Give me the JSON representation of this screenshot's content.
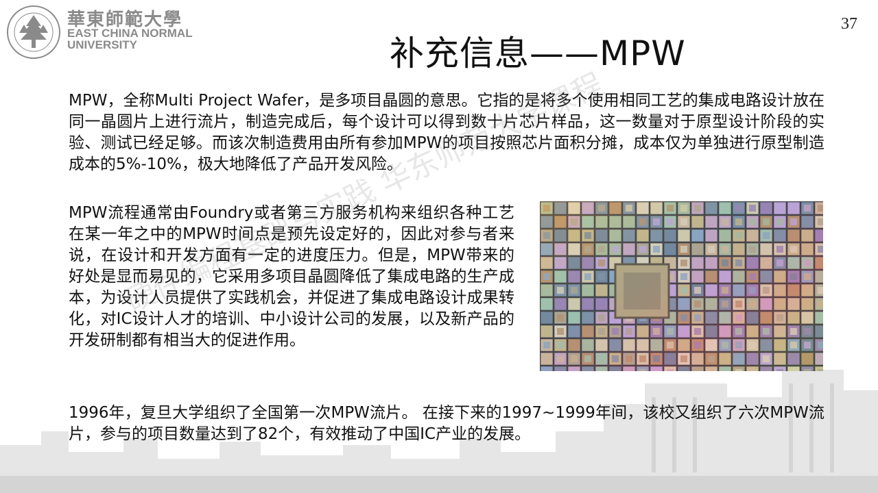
{
  "header": {
    "logo_cn": "華東師範大學",
    "logo_en_line1": "EAST CHINA NORMAL",
    "logo_en_line2": "UNIVERSITY",
    "page_number": "37"
  },
  "slide": {
    "title": "补充信息——MPW",
    "paragraph1": "MPW，全称Multi Project Wafer，是多项目晶圆的意思。它指的是将多个使用相同工艺的集成电路设计放在同一晶圆片上进行流片，制造完成后，每个设计可以得到数十片芯片样品，这一数量对于原型设计阶段的实验、测试已经足够。而该次制造费用由所有参加MPW的项目按照芯片面积分摊，成本仅为单独进行原型制造成本的5%-10%，极大地降低了产品开发风险。",
    "paragraph2": "MPW流程通常由Foundry或者第三方服务机构来组织各种工艺在某一年之中的MPW时间点是预先设定好的，因此对参与者来说，在设计和开发方面有一定的进度压力。但是，MPW带来的好处是显而易见的，它采用多项目晶圆降低了集成电路的生产成本，为设计人员提供了实践机会，并促进了集成电路设计成果转化，对IC设计人才的培训、中小设计公司的发展，以及新产品的开发研制都有相当大的促进作用。",
    "paragraph3": "1996年，复旦大学组织了全国第一次MPW流片。 在接下来的1997~1999年间，该校又组织了六次MPW流片，参与的项目数量达到了82个，有效推动了中国IC产业的发展。",
    "watermark": "硬件编程基础与实践 华东师范大学课程"
  }
}
